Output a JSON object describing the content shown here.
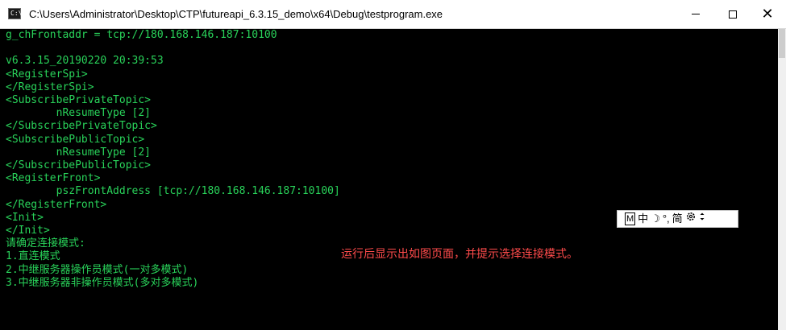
{
  "window": {
    "title": "C:\\Users\\Administrator\\Desktop\\CTP\\futureapi_6.3.15_demo\\x64\\Debug\\testprogram.exe",
    "icon": "console-app-icon",
    "controls": {
      "minimize": "minimize-icon",
      "maximize": "maximize-icon",
      "close": "close-icon",
      "close_glyph": "✕"
    }
  },
  "console": {
    "text_color": "#29d35a",
    "lines": [
      "g_chFrontaddr = tcp://180.168.146.187:10100",
      "",
      "v6.3.15_20190220 20:39:53",
      "<RegisterSpi>",
      "</RegisterSpi>",
      "<SubscribePrivateTopic>",
      "        nResumeType [2]",
      "</SubscribePrivateTopic>",
      "<SubscribePublicTopic>",
      "        nResumeType [2]",
      "</SubscribePublicTopic>",
      "<RegisterFront>",
      "        pszFrontAddress [tcp://180.168.146.187:10100]",
      "</RegisterFront>",
      "<Init>",
      "</Init>",
      "请确定连接模式:",
      "1.直连模式",
      "2.中继服务器操作员模式(一对多模式)",
      "3.中继服务器非操作员模式(多对多模式)"
    ]
  },
  "annotation": {
    "text": "运行后显示出如图页面，并提示选择连接模式。",
    "color": "#ff4b4b"
  },
  "ime_toolbar": {
    "mode": "M",
    "chinese": "中",
    "moon": "☽",
    "punct": "°,",
    "simplified": "简",
    "settings": "gear-icon",
    "menu": "more-icon"
  }
}
